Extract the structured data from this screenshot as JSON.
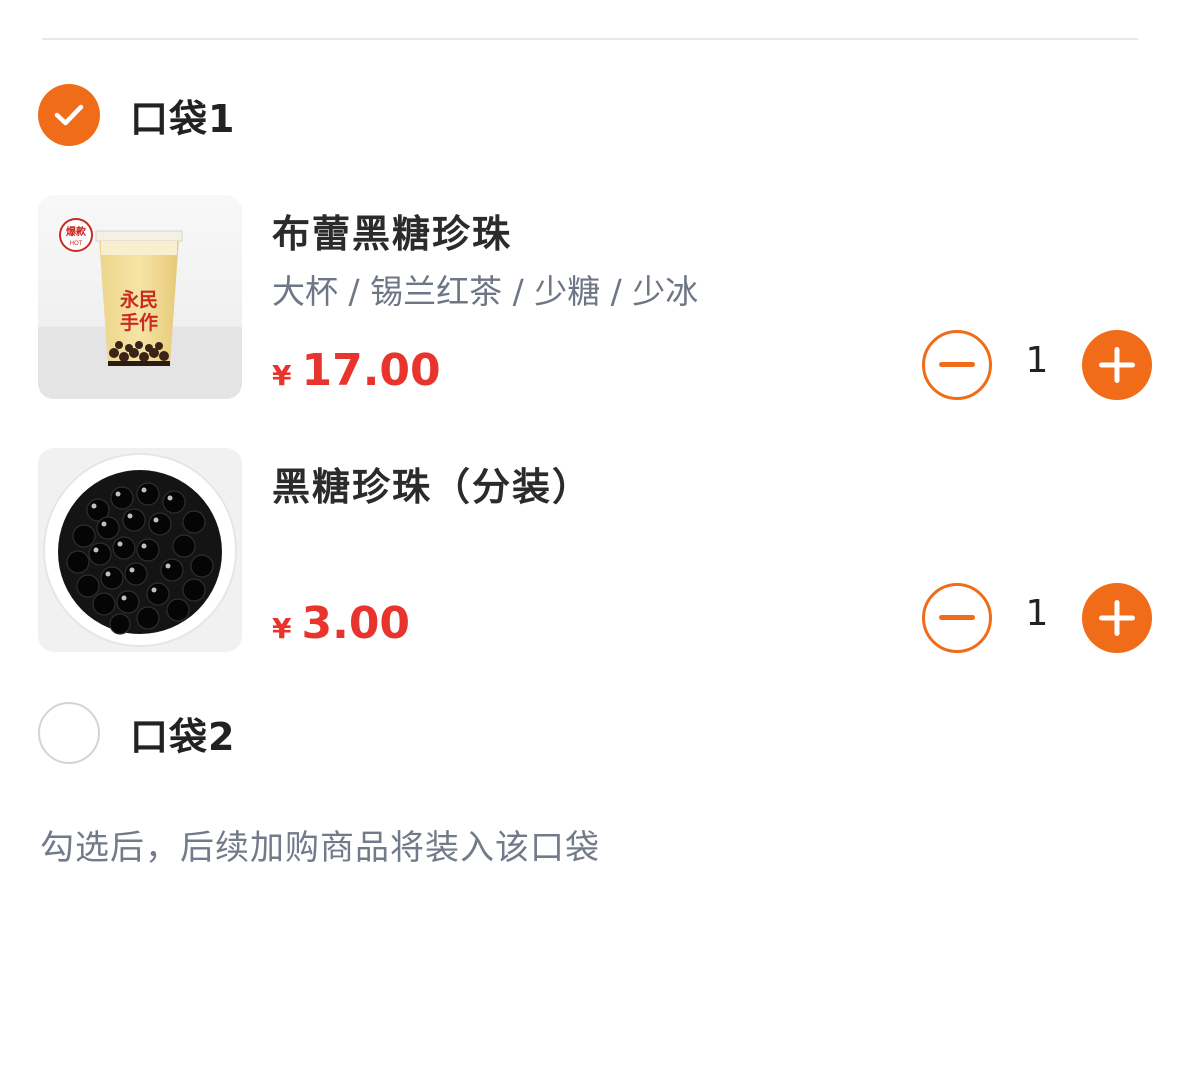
{
  "bags": [
    {
      "title": "口袋1",
      "checked": true,
      "items": [
        {
          "name": "布蕾黑糖珍珠",
          "spec": "大杯 / 锡兰红茶 / 少糖 / 少冰",
          "currency": "¥",
          "price": "17.00",
          "quantity": "1",
          "image_icon": "milk-tea-cup-image",
          "image_text": {
            "badge": "爆款",
            "badge_sub": "HOT",
            "brand_line1": "永民",
            "brand_line2": "手作"
          }
        },
        {
          "name": "黑糖珍珠（分装）",
          "spec": "",
          "currency": "¥",
          "price": "3.00",
          "quantity": "1",
          "image_icon": "tapioca-pearls-bowl-image"
        }
      ]
    },
    {
      "title": "口袋2",
      "checked": false,
      "items": []
    }
  ],
  "hint": "勾选后，后续加购商品将装入该口袋",
  "colors": {
    "accent": "#f06c18",
    "price": "#e8342c",
    "text_primary": "#222222",
    "text_secondary": "#6e7585"
  }
}
